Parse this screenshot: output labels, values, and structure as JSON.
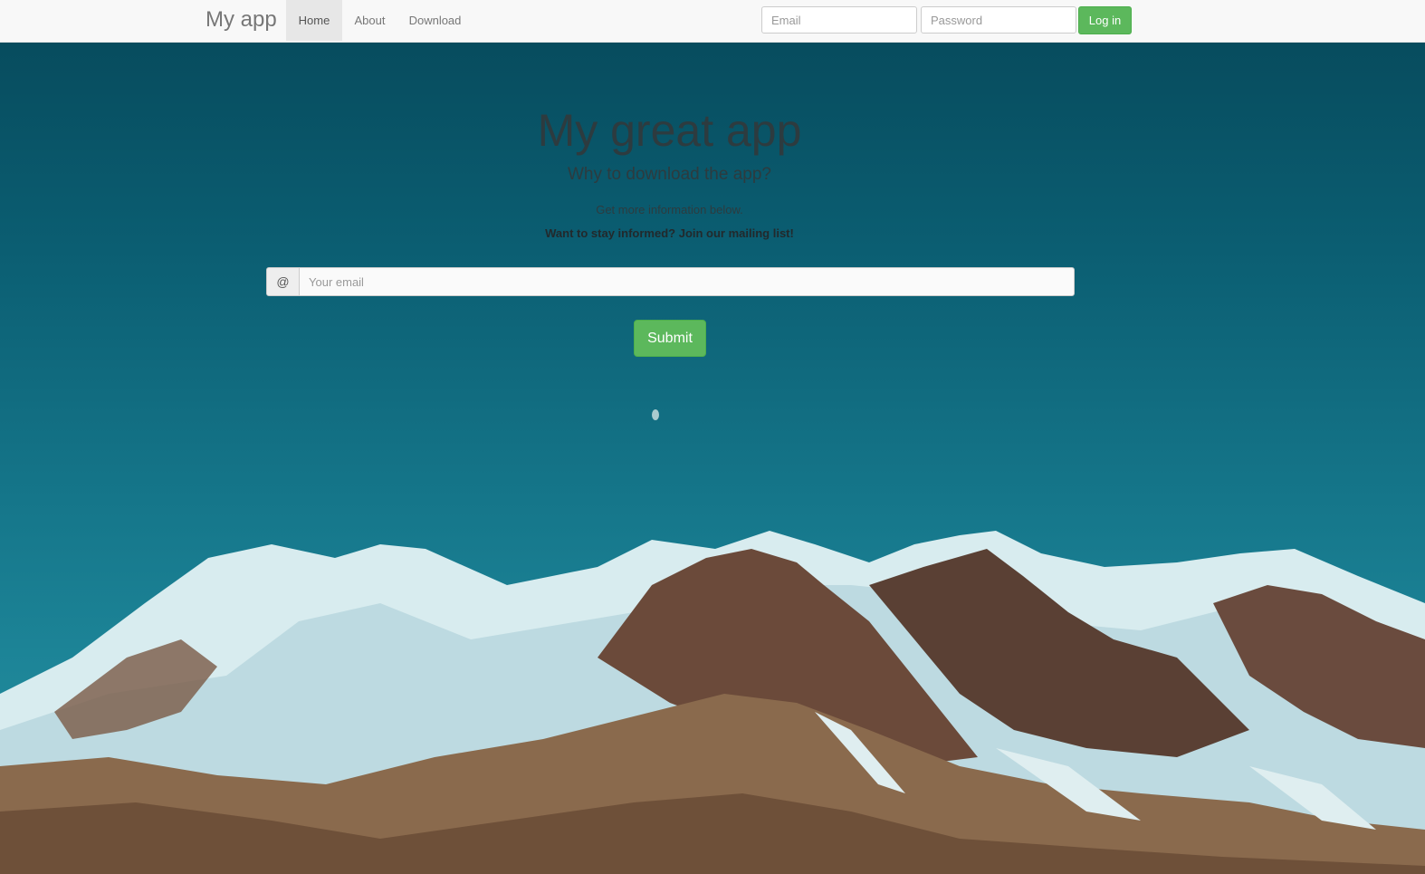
{
  "navbar": {
    "brand": "My app",
    "links": [
      {
        "label": "Home",
        "active": true
      },
      {
        "label": "About",
        "active": false
      },
      {
        "label": "Download",
        "active": false
      }
    ],
    "email_placeholder": "Email",
    "password_placeholder": "Password",
    "login_label": "Log in"
  },
  "hero": {
    "title": "My great app",
    "subtitle": "Why to download the app?",
    "info": "Get more information below.",
    "mailing": "Want to stay informed? Join our mailing list!",
    "addon_symbol": "@",
    "email_placeholder": "Your email",
    "submit_label": "Submit"
  },
  "colors": {
    "navbar_bg": "#f8f8f8",
    "button_green": "#5cb85c",
    "sky_top": "#074c5e",
    "sky_bottom": "#2a8e9e"
  }
}
